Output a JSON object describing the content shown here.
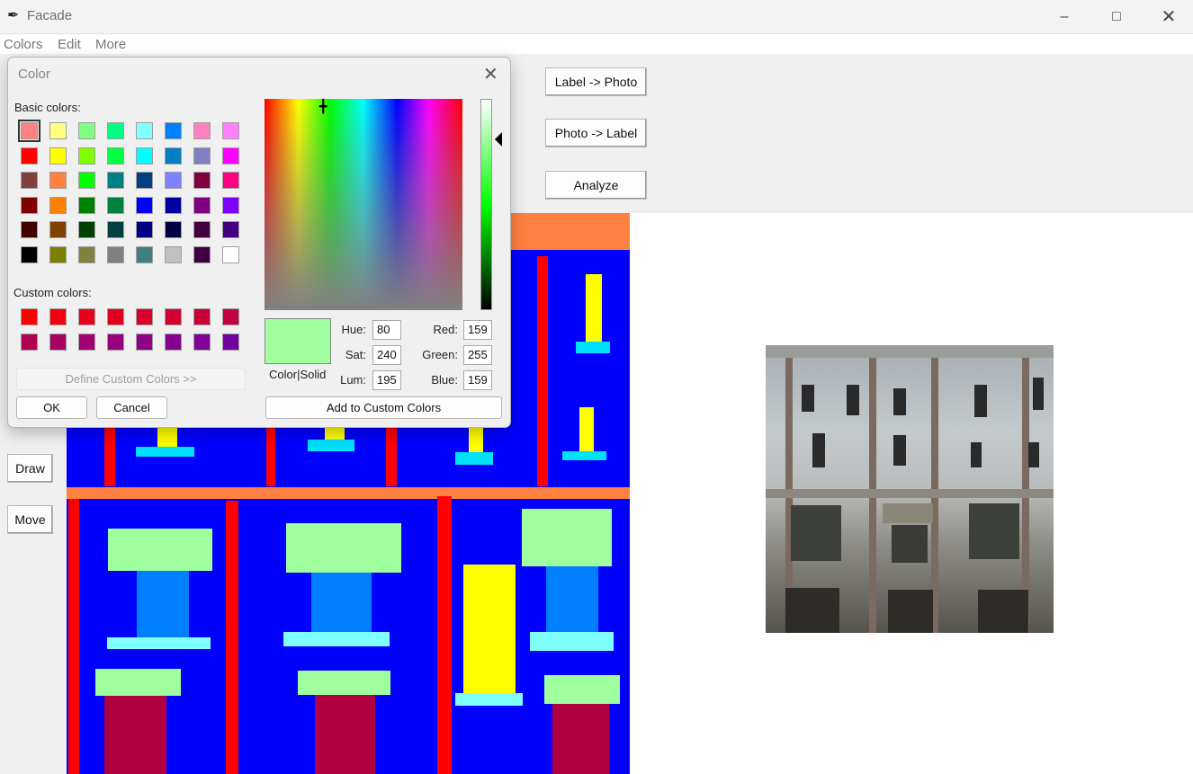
{
  "window": {
    "title": "Facade",
    "controls": [
      "minimize",
      "maximize",
      "close"
    ]
  },
  "menu": [
    "Colors",
    "Edit",
    "More"
  ],
  "toolbar": {
    "label_to_photo": "Label -> Photo",
    "photo_to_label": "Photo -> Label",
    "analyze": "Analyze"
  },
  "tools": {
    "draw": "Draw",
    "move": "Move"
  },
  "dialog": {
    "title": "Color",
    "basic_colors_label": "Basic colors:",
    "custom_colors_label": "Custom colors:",
    "define_custom": "Define Custom Colors >>",
    "ok": "OK",
    "cancel": "Cancel",
    "add_custom": "Add to Custom Colors",
    "preview_label": "Color|Solid",
    "hue_label": "Hue:",
    "hue": "80",
    "sat_label": "Sat:",
    "sat": "240",
    "lum_label": "Lum:",
    "lum": "195",
    "red_label": "Red:",
    "red": "159",
    "green_label": "Green:",
    "green": "255",
    "blue_label": "Blue:",
    "blue": "159",
    "selected_color": "#9fff9f",
    "basic_colors": [
      [
        "#ff8080",
        "#ffff80",
        "#80ff80",
        "#00ff80",
        "#80ffff",
        "#0080ff",
        "#ff80c0",
        "#ff80ff"
      ],
      [
        "#ff0000",
        "#ffff00",
        "#80ff00",
        "#00ff40",
        "#00ffff",
        "#0080c0",
        "#8080c0",
        "#ff00ff"
      ],
      [
        "#804040",
        "#ff8040",
        "#00ff00",
        "#008080",
        "#004080",
        "#8080ff",
        "#800040",
        "#ff0080"
      ],
      [
        "#800000",
        "#ff8000",
        "#008000",
        "#008040",
        "#0000ff",
        "#0000a0",
        "#800080",
        "#8000ff"
      ],
      [
        "#400000",
        "#804000",
        "#004000",
        "#004040",
        "#000080",
        "#000040",
        "#400040",
        "#400080"
      ],
      [
        "#000000",
        "#808000",
        "#808040",
        "#808080",
        "#408080",
        "#c0c0c0",
        "#400040",
        "#ffffff"
      ]
    ],
    "custom_colors": [
      [
        "#ff0000",
        "#f00010",
        "#e80018",
        "#e00020",
        "#d80028",
        "#d00030",
        "#c80038",
        "#c00040"
      ],
      [
        "#b00050",
        "#a80060",
        "#a00070",
        "#980080",
        "#900088",
        "#880090",
        "#800098",
        "#7000a0"
      ]
    ]
  },
  "colors": {
    "wall": "#0000ff",
    "pillar": "#ff0000",
    "molding": "#ff8040",
    "window": "#9fff9f",
    "glass": "#0080ff",
    "sill": "#80ffff",
    "door": "#b00040",
    "deco": "#ffff00",
    "deco_base": "#00e0ff"
  }
}
